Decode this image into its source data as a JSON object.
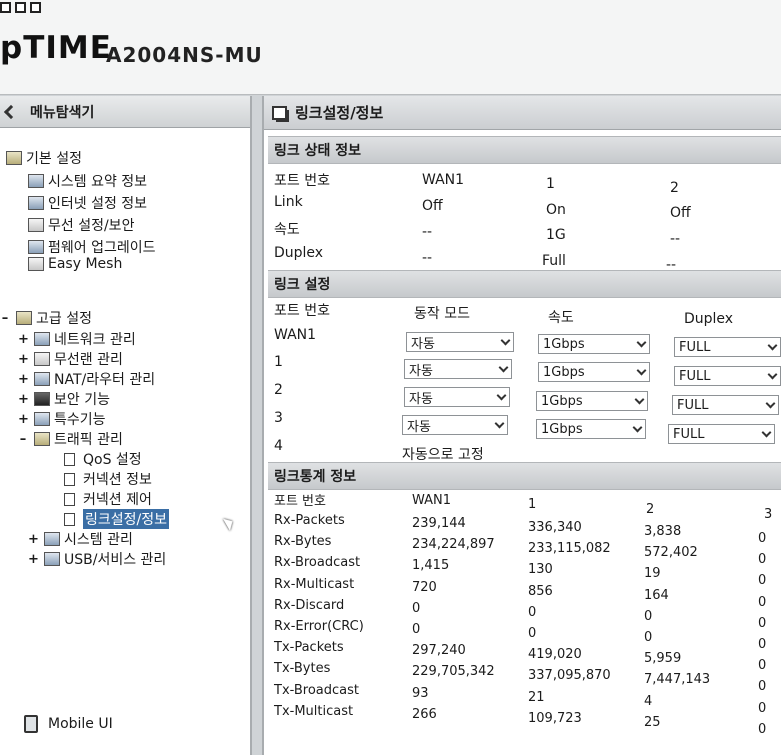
{
  "header": {
    "brand": "pTIME",
    "model": "A2004NS-MU"
  },
  "sidebar": {
    "title": "메뉴탐색기",
    "basic": {
      "label": "기본 설정",
      "items": [
        "시스템 요약 정보",
        "인터넷 설정 정보",
        "무선 설정/보안",
        "펌웨어 업그레이드",
        "Easy Mesh"
      ]
    },
    "advanced": {
      "label": "고급 설정",
      "items": [
        "네트워크 관리",
        "무선랜 관리",
        "NAT/라우터 관리",
        "보안 기능",
        "특수기능",
        "트래픽 관리"
      ],
      "traffic_sub": [
        "QoS 설정",
        "커넥션 정보",
        "커넥션 제어",
        "링크설정/정보"
      ],
      "after": [
        "시스템 관리",
        "USB/서비스 관리"
      ]
    },
    "mobile_ui": "Mobile UI"
  },
  "main": {
    "title": "링크설정/정보",
    "status": {
      "section": "링크 상태 정보",
      "headers": [
        "포트 번호",
        "WAN1",
        "1",
        "2"
      ],
      "rows": [
        {
          "label": "Link",
          "values": [
            "Off",
            "On",
            "Off"
          ]
        },
        {
          "label": "속도",
          "values": [
            "--",
            "1G",
            "--"
          ]
        },
        {
          "label": "Duplex",
          "values": [
            "--",
            "Full",
            "--"
          ]
        }
      ]
    },
    "config": {
      "section": "링크 설정",
      "headers": [
        "포트 번호",
        "동작 모드",
        "속도",
        "Duplex"
      ],
      "rows": [
        {
          "port": "WAN1",
          "mode": "자동",
          "speed": "1Gbps",
          "duplex": "FULL"
        },
        {
          "port": "1",
          "mode": "자동",
          "speed": "1Gbps",
          "duplex": "FULL"
        },
        {
          "port": "2",
          "mode": "자동",
          "speed": "1Gbps",
          "duplex": "FULL"
        },
        {
          "port": "3",
          "mode": "자동",
          "speed": "1Gbps",
          "duplex": "FULL"
        }
      ],
      "fixed_row": {
        "port": "4",
        "text": "자동으로 고정"
      }
    },
    "stats": {
      "section": "링크통계 정보",
      "headers": [
        "포트 번호",
        "WAN1",
        "1",
        "2",
        "3"
      ],
      "rows": [
        {
          "label": "Rx-Packets",
          "values": [
            "239,144",
            "336,340",
            "3,838",
            "0"
          ]
        },
        {
          "label": "Rx-Bytes",
          "values": [
            "234,224,897",
            "233,115,082",
            "572,402",
            "0"
          ]
        },
        {
          "label": "Rx-Broadcast",
          "values": [
            "1,415",
            "130",
            "19",
            "0"
          ]
        },
        {
          "label": "Rx-Multicast",
          "values": [
            "720",
            "856",
            "164",
            "0"
          ]
        },
        {
          "label": "Rx-Discard",
          "values": [
            "0",
            "0",
            "0",
            "0"
          ]
        },
        {
          "label": "Rx-Error(CRC)",
          "values": [
            "0",
            "0",
            "0",
            "0"
          ]
        },
        {
          "label": "Tx-Packets",
          "values": [
            "297,240",
            "419,020",
            "5,959",
            "0"
          ]
        },
        {
          "label": "Tx-Bytes",
          "values": [
            "229,705,342",
            "337,095,870",
            "7,447,143",
            "0"
          ]
        },
        {
          "label": "Tx-Broadcast",
          "values": [
            "93",
            "21",
            "4",
            "0"
          ]
        },
        {
          "label": "Tx-Multicast",
          "values": [
            "266",
            "109,723",
            "25",
            "0"
          ]
        }
      ]
    }
  }
}
